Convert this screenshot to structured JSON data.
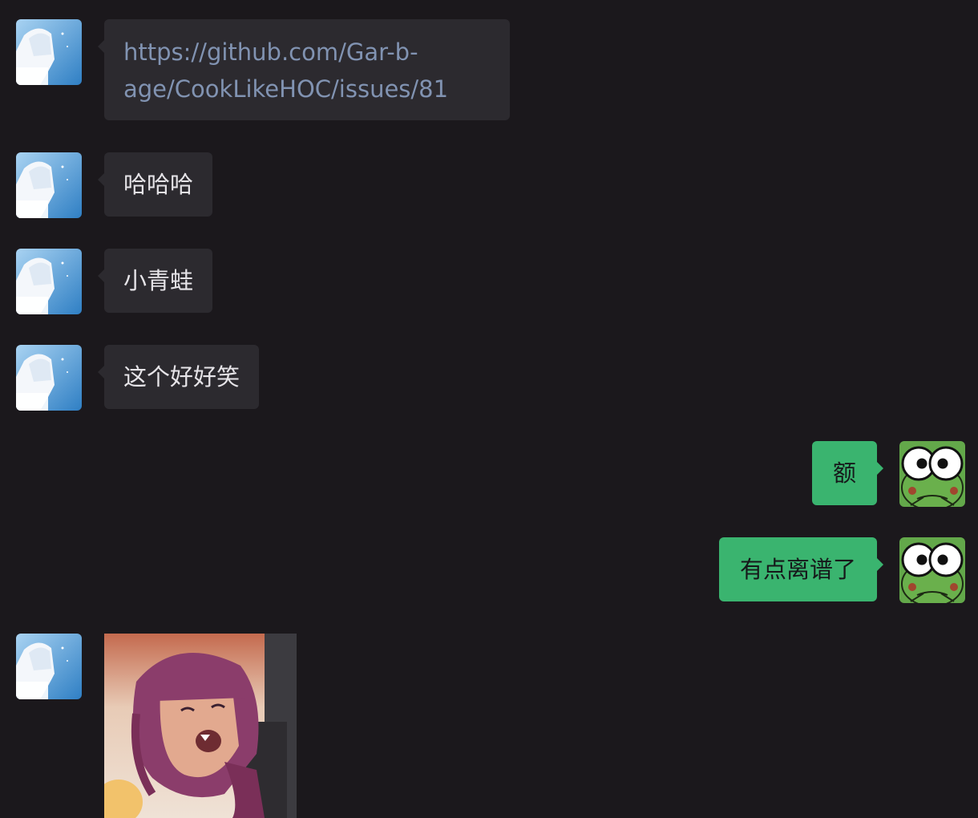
{
  "messages": [
    {
      "side": "in",
      "text": "https://github.com/Gar-b-age/CookLikeHOC/issues/81"
    },
    {
      "side": "in",
      "text": "哈哈哈"
    },
    {
      "side": "in",
      "text": "小青蛙"
    },
    {
      "side": "in",
      "text": "这个好好笑"
    },
    {
      "side": "out",
      "text": "额"
    },
    {
      "side": "out",
      "text": "有点离谱了"
    },
    {
      "side": "in",
      "type": "image"
    }
  ],
  "colors": {
    "background": "#1b181c",
    "incoming_bubble": "#2c2a2f",
    "outgoing_bubble": "#3ab46f",
    "link_text": "#8193b2"
  },
  "icons": {
    "contact_avatar": "anime-girl-avatar",
    "self_avatar": "frog-avatar"
  }
}
